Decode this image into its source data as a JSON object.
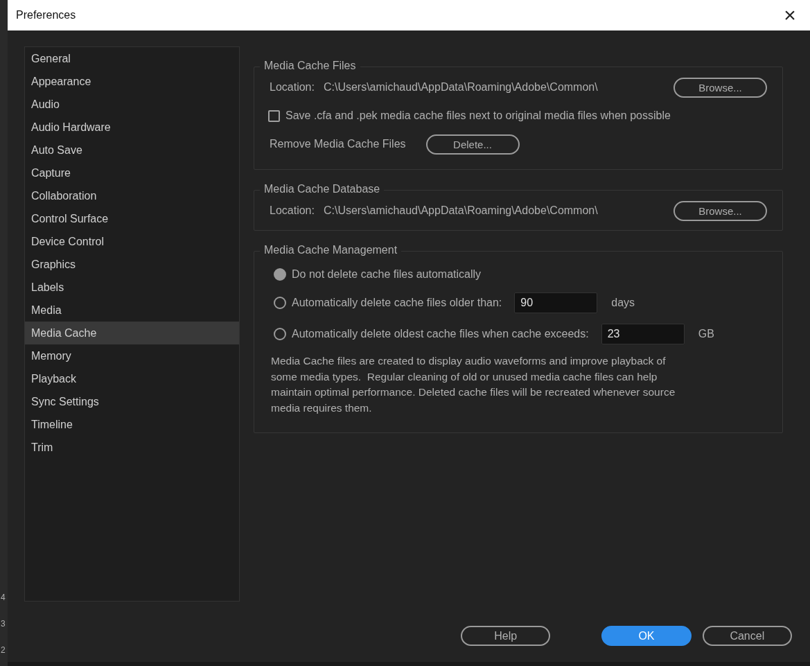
{
  "background_app": {
    "row_numbers": [
      "4",
      "3",
      "2"
    ]
  },
  "window": {
    "title": "Preferences",
    "close": "×"
  },
  "sidebar": {
    "items": [
      {
        "label": "General",
        "selected": false
      },
      {
        "label": "Appearance",
        "selected": false
      },
      {
        "label": "Audio",
        "selected": false
      },
      {
        "label": "Audio Hardware",
        "selected": false
      },
      {
        "label": "Auto Save",
        "selected": false
      },
      {
        "label": "Capture",
        "selected": false
      },
      {
        "label": "Collaboration",
        "selected": false
      },
      {
        "label": "Control Surface",
        "selected": false
      },
      {
        "label": "Device Control",
        "selected": false
      },
      {
        "label": "Graphics",
        "selected": false
      },
      {
        "label": "Labels",
        "selected": false
      },
      {
        "label": "Media",
        "selected": false
      },
      {
        "label": "Media Cache",
        "selected": true
      },
      {
        "label": "Memory",
        "selected": false
      },
      {
        "label": "Playback",
        "selected": false
      },
      {
        "label": "Sync Settings",
        "selected": false
      },
      {
        "label": "Timeline",
        "selected": false
      },
      {
        "label": "Trim",
        "selected": false
      }
    ]
  },
  "media_cache_files": {
    "title": "Media Cache Files",
    "location_label": "Location:",
    "location": "C:\\Users\\amichaud\\AppData\\Roaming\\Adobe\\Common\\",
    "browse": "Browse...",
    "save_next": {
      "label": "Save .cfa and .pek media cache files next to original media files when possible",
      "checked": false
    },
    "remove_label": "Remove Media Cache Files",
    "delete": "Delete..."
  },
  "media_cache_database": {
    "title": "Media Cache Database",
    "location_label": "Location:",
    "location": "C:\\Users\\amichaud\\AppData\\Roaming\\Adobe\\Common\\",
    "browse": "Browse..."
  },
  "media_cache_management": {
    "title": "Media Cache Management",
    "options": [
      {
        "label": "Do not delete cache files automatically",
        "selected": true
      },
      {
        "label": "Automatically delete cache files older than:",
        "selected": false,
        "value": "90",
        "unit": "days"
      },
      {
        "label": "Automatically delete oldest cache files when cache exceeds:",
        "selected": false,
        "value": "23",
        "unit": "GB"
      }
    ],
    "note": "Media Cache files are created to display audio waveforms and improve playback of some media types.  Regular cleaning of old or unused media cache files can help maintain optimal performance. Deleted cache files will be recreated whenever source media requires them."
  },
  "buttons": {
    "help": "Help",
    "ok": "OK",
    "cancel": "Cancel"
  }
}
